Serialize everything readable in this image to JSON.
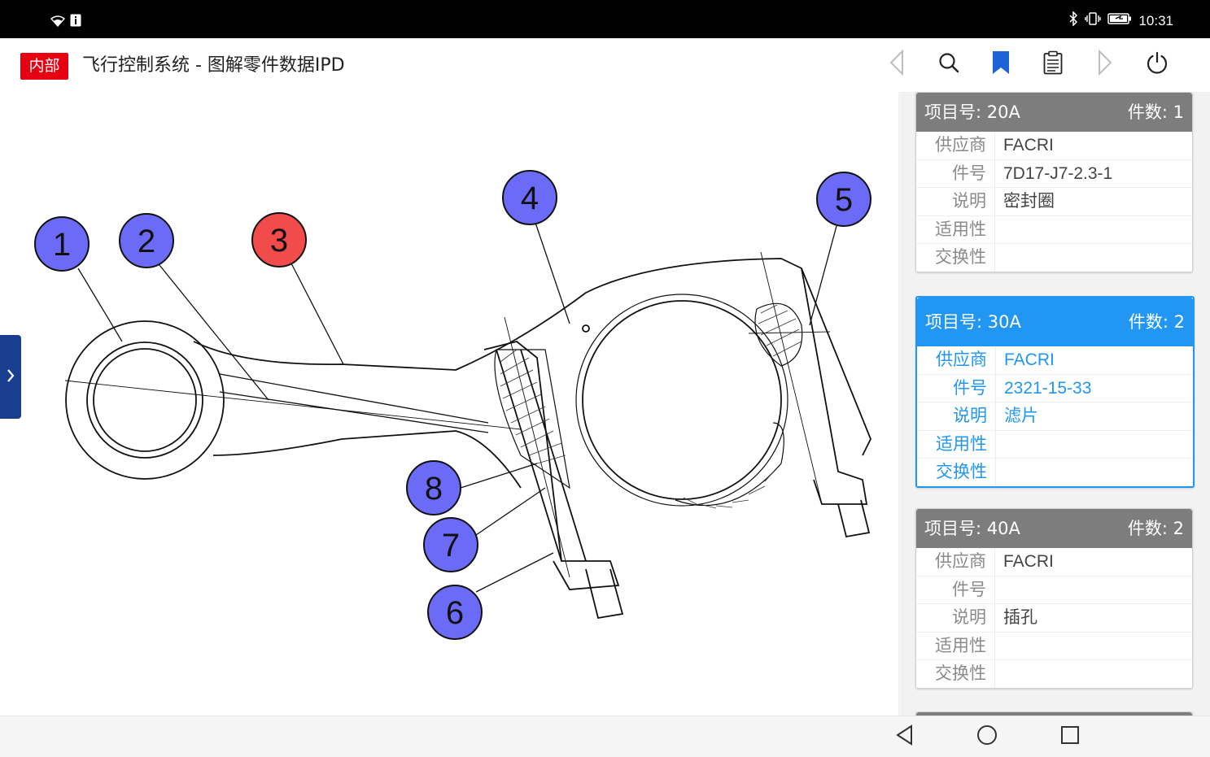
{
  "status_bar": {
    "time": "10:31"
  },
  "app_bar": {
    "badge": "内部",
    "title": "飞行控制系统 - 图解零件数据IPD"
  },
  "toolbar_icons": [
    "back-triangle-icon",
    "search-icon",
    "bookmark-icon",
    "clipboard-icon",
    "forward-triangle-icon",
    "power-icon"
  ],
  "colors": {
    "accent": "#2196f3",
    "badge": "#e60012",
    "callout_blue": "#6b6bf7",
    "callout_red": "#f24b4b",
    "header_gray": "#7d7d7d"
  },
  "diagram": {
    "callouts": [
      {
        "label": "1",
        "state": "normal"
      },
      {
        "label": "2",
        "state": "normal"
      },
      {
        "label": "3",
        "state": "selected"
      },
      {
        "label": "4",
        "state": "normal"
      },
      {
        "label": "5",
        "state": "normal"
      },
      {
        "label": "6",
        "state": "normal"
      },
      {
        "label": "7",
        "state": "normal"
      },
      {
        "label": "8",
        "state": "normal"
      }
    ]
  },
  "parts_panel": {
    "field_labels": {
      "supplier": "供应商",
      "part_no": "件号",
      "desc": "说明",
      "applic": "适用性",
      "interch": "交换性"
    },
    "items": [
      {
        "item_label": "项目号: 20A",
        "qty_label": "件数: 1",
        "supplier": "FACRI",
        "part_no": "7D17-J7-2.3-1",
        "desc": "密封圈",
        "applic": "",
        "interch": ""
      },
      {
        "item_label": "项目号: 30A",
        "qty_label": "件数: 2",
        "supplier": "FACRI",
        "part_no": "2321-15-33",
        "desc": "滤片",
        "applic": "",
        "interch": "",
        "active": true
      },
      {
        "item_label": "项目号: 40A",
        "qty_label": "件数: 2",
        "supplier": "FACRI",
        "part_no": "",
        "desc": "插孔",
        "applic": "",
        "interch": ""
      }
    ]
  },
  "nav_bar": [
    "back-icon",
    "home-icon",
    "recents-icon"
  ]
}
